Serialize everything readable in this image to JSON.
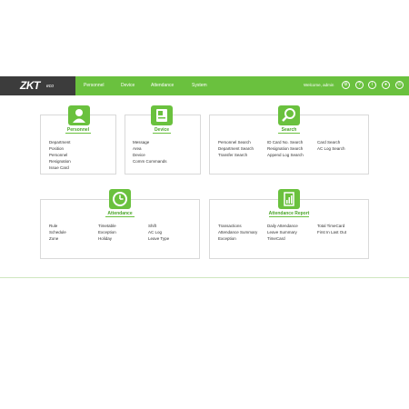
{
  "app": {
    "logo_main": "ZKT",
    "logo_sub": "eco"
  },
  "nav": [
    "Personnel",
    "Device",
    "Attendance",
    "System"
  ],
  "welcome": "Welcome, admin",
  "header_icons": [
    "gear-icon",
    "help-icon",
    "info-icon",
    "user-icon",
    "logout-icon"
  ],
  "panels": {
    "personnel": {
      "title": "Personnel",
      "links": [
        "Department",
        "Position",
        "Personnel",
        "Resignation",
        "Issue Card"
      ]
    },
    "device": {
      "title": "Device",
      "links": [
        "Message",
        "Area",
        "Device",
        "Comm Commands"
      ]
    },
    "search": {
      "title": "Search",
      "links": [
        "Personnel Search",
        "Department Search",
        "Transfer Search",
        "ID Card No. Search",
        "Resignation Search",
        "Append Log Search",
        "Card Search",
        "AC Log Search"
      ]
    },
    "attendance": {
      "title": "Attendance",
      "links": [
        "Rule",
        "Schedule",
        "Zone",
        "Timetable",
        "Exception",
        "Holiday",
        "Shift",
        "AC Log",
        "Leave Type"
      ]
    },
    "report": {
      "title": "Attendance Report",
      "links": [
        "Transactions",
        "Attendance Summary",
        "Exception",
        "Daily Attendance",
        "Leave Summary",
        "TimeCard",
        "Total TimeCard",
        "First In Last Out"
      ]
    }
  }
}
